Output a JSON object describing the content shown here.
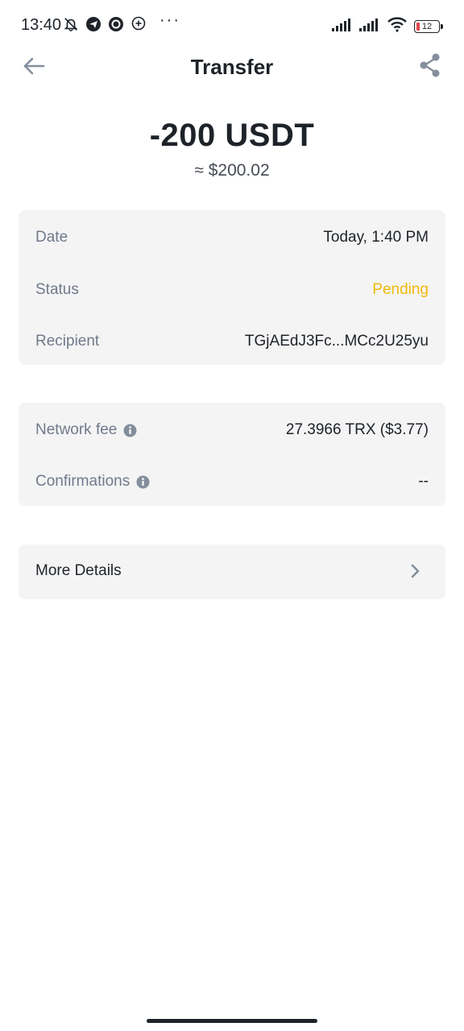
{
  "status_bar": {
    "time": "13:40",
    "dots": "···",
    "battery_level": "12"
  },
  "header": {
    "title": "Transfer"
  },
  "amount": {
    "value": "-200 USDT",
    "fiat": "≈ $200.02"
  },
  "details": {
    "date_label": "Date",
    "date_value": "Today, 1:40 PM",
    "status_label": "Status",
    "status_value": "Pending",
    "recipient_label": "Recipient",
    "recipient_value": "TGjAEdJ3Fc...MCc2U25yu"
  },
  "fees": {
    "network_fee_label": "Network fee",
    "network_fee_value": "27.3966 TRX ($3.77)",
    "confirmations_label": "Confirmations",
    "confirmations_value": "--"
  },
  "more_details": {
    "label": "More Details"
  },
  "colors": {
    "pending": "#f0b90b",
    "card_bg": "#f4f4f5",
    "label": "#707a8a",
    "text": "#1e2329"
  },
  "icons": {
    "back": "arrow-left-icon",
    "share": "share-icon",
    "info": "info-icon",
    "chevron": "chevron-right-icon"
  }
}
